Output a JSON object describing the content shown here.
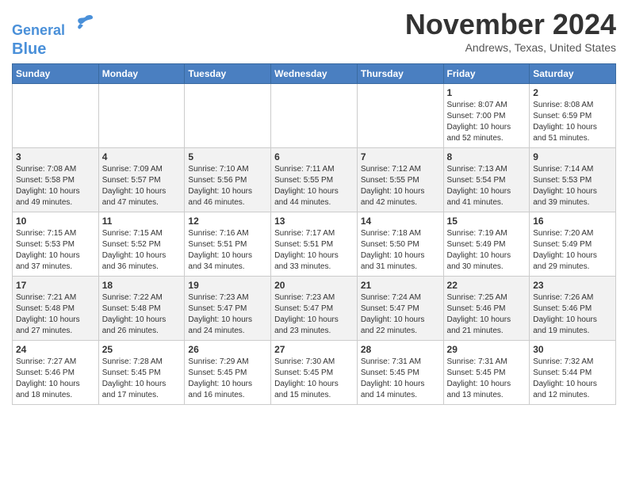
{
  "header": {
    "logo_line1": "General",
    "logo_line2": "Blue",
    "month": "November 2024",
    "location": "Andrews, Texas, United States"
  },
  "weekdays": [
    "Sunday",
    "Monday",
    "Tuesday",
    "Wednesday",
    "Thursday",
    "Friday",
    "Saturday"
  ],
  "weeks": [
    [
      {
        "day": "",
        "info": ""
      },
      {
        "day": "",
        "info": ""
      },
      {
        "day": "",
        "info": ""
      },
      {
        "day": "",
        "info": ""
      },
      {
        "day": "",
        "info": ""
      },
      {
        "day": "1",
        "info": "Sunrise: 8:07 AM\nSunset: 7:00 PM\nDaylight: 10 hours\nand 52 minutes."
      },
      {
        "day": "2",
        "info": "Sunrise: 8:08 AM\nSunset: 6:59 PM\nDaylight: 10 hours\nand 51 minutes."
      }
    ],
    [
      {
        "day": "3",
        "info": "Sunrise: 7:08 AM\nSunset: 5:58 PM\nDaylight: 10 hours\nand 49 minutes."
      },
      {
        "day": "4",
        "info": "Sunrise: 7:09 AM\nSunset: 5:57 PM\nDaylight: 10 hours\nand 47 minutes."
      },
      {
        "day": "5",
        "info": "Sunrise: 7:10 AM\nSunset: 5:56 PM\nDaylight: 10 hours\nand 46 minutes."
      },
      {
        "day": "6",
        "info": "Sunrise: 7:11 AM\nSunset: 5:55 PM\nDaylight: 10 hours\nand 44 minutes."
      },
      {
        "day": "7",
        "info": "Sunrise: 7:12 AM\nSunset: 5:55 PM\nDaylight: 10 hours\nand 42 minutes."
      },
      {
        "day": "8",
        "info": "Sunrise: 7:13 AM\nSunset: 5:54 PM\nDaylight: 10 hours\nand 41 minutes."
      },
      {
        "day": "9",
        "info": "Sunrise: 7:14 AM\nSunset: 5:53 PM\nDaylight: 10 hours\nand 39 minutes."
      }
    ],
    [
      {
        "day": "10",
        "info": "Sunrise: 7:15 AM\nSunset: 5:53 PM\nDaylight: 10 hours\nand 37 minutes."
      },
      {
        "day": "11",
        "info": "Sunrise: 7:15 AM\nSunset: 5:52 PM\nDaylight: 10 hours\nand 36 minutes."
      },
      {
        "day": "12",
        "info": "Sunrise: 7:16 AM\nSunset: 5:51 PM\nDaylight: 10 hours\nand 34 minutes."
      },
      {
        "day": "13",
        "info": "Sunrise: 7:17 AM\nSunset: 5:51 PM\nDaylight: 10 hours\nand 33 minutes."
      },
      {
        "day": "14",
        "info": "Sunrise: 7:18 AM\nSunset: 5:50 PM\nDaylight: 10 hours\nand 31 minutes."
      },
      {
        "day": "15",
        "info": "Sunrise: 7:19 AM\nSunset: 5:49 PM\nDaylight: 10 hours\nand 30 minutes."
      },
      {
        "day": "16",
        "info": "Sunrise: 7:20 AM\nSunset: 5:49 PM\nDaylight: 10 hours\nand 29 minutes."
      }
    ],
    [
      {
        "day": "17",
        "info": "Sunrise: 7:21 AM\nSunset: 5:48 PM\nDaylight: 10 hours\nand 27 minutes."
      },
      {
        "day": "18",
        "info": "Sunrise: 7:22 AM\nSunset: 5:48 PM\nDaylight: 10 hours\nand 26 minutes."
      },
      {
        "day": "19",
        "info": "Sunrise: 7:23 AM\nSunset: 5:47 PM\nDaylight: 10 hours\nand 24 minutes."
      },
      {
        "day": "20",
        "info": "Sunrise: 7:23 AM\nSunset: 5:47 PM\nDaylight: 10 hours\nand 23 minutes."
      },
      {
        "day": "21",
        "info": "Sunrise: 7:24 AM\nSunset: 5:47 PM\nDaylight: 10 hours\nand 22 minutes."
      },
      {
        "day": "22",
        "info": "Sunrise: 7:25 AM\nSunset: 5:46 PM\nDaylight: 10 hours\nand 21 minutes."
      },
      {
        "day": "23",
        "info": "Sunrise: 7:26 AM\nSunset: 5:46 PM\nDaylight: 10 hours\nand 19 minutes."
      }
    ],
    [
      {
        "day": "24",
        "info": "Sunrise: 7:27 AM\nSunset: 5:46 PM\nDaylight: 10 hours\nand 18 minutes."
      },
      {
        "day": "25",
        "info": "Sunrise: 7:28 AM\nSunset: 5:45 PM\nDaylight: 10 hours\nand 17 minutes."
      },
      {
        "day": "26",
        "info": "Sunrise: 7:29 AM\nSunset: 5:45 PM\nDaylight: 10 hours\nand 16 minutes."
      },
      {
        "day": "27",
        "info": "Sunrise: 7:30 AM\nSunset: 5:45 PM\nDaylight: 10 hours\nand 15 minutes."
      },
      {
        "day": "28",
        "info": "Sunrise: 7:31 AM\nSunset: 5:45 PM\nDaylight: 10 hours\nand 14 minutes."
      },
      {
        "day": "29",
        "info": "Sunrise: 7:31 AM\nSunset: 5:45 PM\nDaylight: 10 hours\nand 13 minutes."
      },
      {
        "day": "30",
        "info": "Sunrise: 7:32 AM\nSunset: 5:44 PM\nDaylight: 10 hours\nand 12 minutes."
      }
    ]
  ]
}
